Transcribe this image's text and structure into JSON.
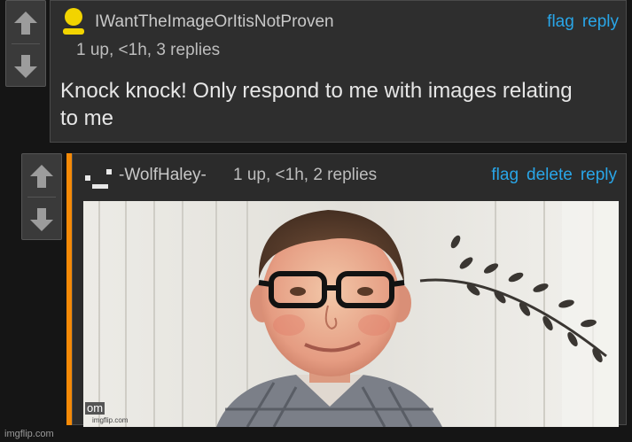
{
  "comment1": {
    "username": "IWantTheImageOrItisNotProven",
    "meta": "1 up, <1h, 3 replies",
    "body": "Knock knock! Only respond to me with images relating to me",
    "actions": [
      "flag",
      "reply"
    ]
  },
  "comment2": {
    "username": "-WolfHaley-",
    "meta": "1 up, <1h, 2 replies",
    "actions": [
      "flag",
      "delete",
      "reply"
    ],
    "image_watermark": "om",
    "image_watermark_small": "imgflip.com"
  },
  "footer": {
    "watermark": "imgflip.com"
  },
  "colors": {
    "link": "#29a6e8",
    "accent_bar": "#f58a07",
    "avatar": "#f2d400"
  },
  "icons": {
    "upvote": "arrow-up-icon",
    "downvote": "arrow-down-icon"
  }
}
